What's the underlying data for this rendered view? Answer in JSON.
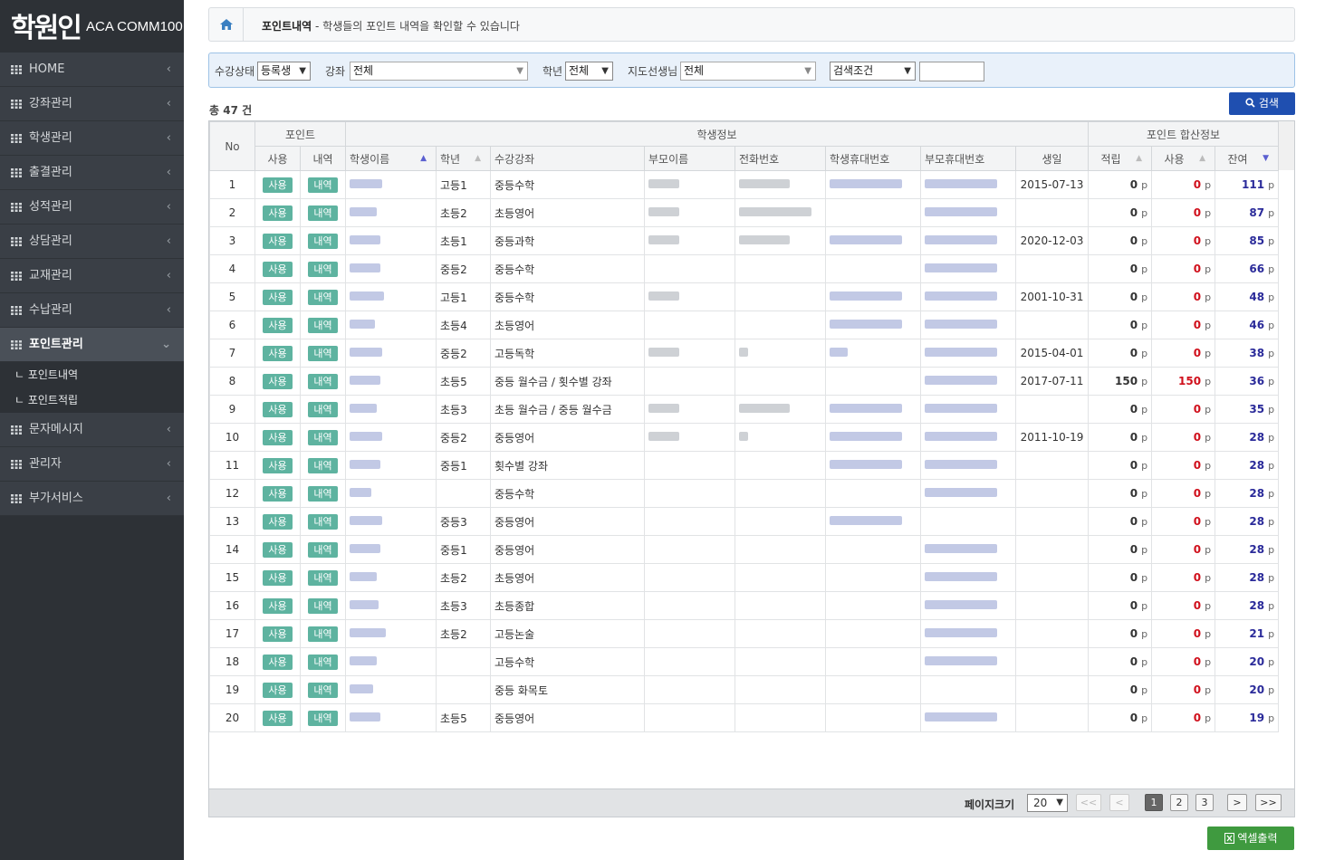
{
  "logo": {
    "mark": "학원인",
    "sub": "ACA COMM100"
  },
  "menu": [
    {
      "label": "HOME"
    },
    {
      "label": "강좌관리"
    },
    {
      "label": "학생관리"
    },
    {
      "label": "출결관리"
    },
    {
      "label": "성적관리"
    },
    {
      "label": "상담관리"
    },
    {
      "label": "교재관리"
    },
    {
      "label": "수납관리"
    },
    {
      "label": "포인트관리"
    },
    {
      "label": "문자메시지"
    },
    {
      "label": "관리자"
    },
    {
      "label": "부가서비스"
    }
  ],
  "submenu": [
    "ㄴ 포인트내역",
    "ㄴ 포인트적립"
  ],
  "breadcrumb": {
    "title": "포인트내역",
    "desc": " - 학생들의 포인트 내역을 확인할 수 있습니다"
  },
  "filter": {
    "status_label": "수강상태",
    "status_value": "등록생",
    "course_label": "강좌",
    "course_value": "전체",
    "grade_label": "학년",
    "grade_value": "전체",
    "teacher_label": "지도선생님",
    "teacher_value": "전체",
    "cond_value": "검색조건",
    "search_value": ""
  },
  "search_button": "검색",
  "total": "총 47 건",
  "headers": {
    "no": "No",
    "point": "포인트",
    "student_info": "학생정보",
    "point_sum": "포인트 합산정보",
    "use": "사용",
    "history": "내역",
    "name": "학생이름",
    "grade": "학년",
    "course": "수강강좌",
    "parent": "부모이름",
    "phone": "전화번호",
    "student_mobile": "학생휴대번호",
    "parent_mobile": "부모휴대번호",
    "birth": "생일",
    "earn": "적립",
    "spent": "사용",
    "balance": "잔여"
  },
  "tags": {
    "use": "사용",
    "history": "내역"
  },
  "unit": "p",
  "rows": [
    {
      "no": "1",
      "grade": "고등1",
      "course": "중등수학",
      "birth": "2015-07-13",
      "earn": "0",
      "spent": "0",
      "balance": "111"
    },
    {
      "no": "2",
      "grade": "초등2",
      "course": "초등영어",
      "birth": "",
      "earn": "0",
      "spent": "0",
      "balance": "87"
    },
    {
      "no": "3",
      "grade": "초등1",
      "course": "중등과학",
      "birth": "2020-12-03",
      "earn": "0",
      "spent": "0",
      "balance": "85"
    },
    {
      "no": "4",
      "grade": "중등2",
      "course": "중등수학",
      "birth": "",
      "earn": "0",
      "spent": "0",
      "balance": "66"
    },
    {
      "no": "5",
      "grade": "고등1",
      "course": "중등수학",
      "birth": "2001-10-31",
      "earn": "0",
      "spent": "0",
      "balance": "48"
    },
    {
      "no": "6",
      "grade": "초등4",
      "course": "초등영어",
      "birth": "",
      "earn": "0",
      "spent": "0",
      "balance": "46"
    },
    {
      "no": "7",
      "grade": "중등2",
      "course": "고등독학",
      "birth": "2015-04-01",
      "earn": "0",
      "spent": "0",
      "balance": "38"
    },
    {
      "no": "8",
      "grade": "초등5",
      "course": "중등 월수금 / 횟수별 강좌",
      "birth": "2017-07-11",
      "earn": "150",
      "spent": "150",
      "balance": "36"
    },
    {
      "no": "9",
      "grade": "초등3",
      "course": "초등 월수금 / 중등 월수금",
      "birth": "",
      "earn": "0",
      "spent": "0",
      "balance": "35"
    },
    {
      "no": "10",
      "grade": "중등2",
      "course": "중등영어",
      "birth": "2011-10-19",
      "earn": "0",
      "spent": "0",
      "balance": "28"
    },
    {
      "no": "11",
      "grade": "중등1",
      "course": "횟수별 강좌",
      "birth": "",
      "earn": "0",
      "spent": "0",
      "balance": "28"
    },
    {
      "no": "12",
      "grade": "",
      "course": "중등수학",
      "birth": "",
      "earn": "0",
      "spent": "0",
      "balance": "28"
    },
    {
      "no": "13",
      "grade": "중등3",
      "course": "중등영어",
      "birth": "",
      "earn": "0",
      "spent": "0",
      "balance": "28"
    },
    {
      "no": "14",
      "grade": "중등1",
      "course": "중등영어",
      "birth": "",
      "earn": "0",
      "spent": "0",
      "balance": "28"
    },
    {
      "no": "15",
      "grade": "초등2",
      "course": "초등영어",
      "birth": "",
      "earn": "0",
      "spent": "0",
      "balance": "28"
    },
    {
      "no": "16",
      "grade": "초등3",
      "course": "초등종합",
      "birth": "",
      "earn": "0",
      "spent": "0",
      "balance": "28"
    },
    {
      "no": "17",
      "grade": "초등2",
      "course": "고등논술",
      "birth": "",
      "earn": "0",
      "spent": "0",
      "balance": "21"
    },
    {
      "no": "18",
      "grade": "",
      "course": "고등수학",
      "birth": "",
      "earn": "0",
      "spent": "0",
      "balance": "20"
    },
    {
      "no": "19",
      "grade": "",
      "course": "중등 화목토",
      "birth": "",
      "earn": "0",
      "spent": "0",
      "balance": "20"
    },
    {
      "no": "20",
      "grade": "초등5",
      "course": "중등영어",
      "birth": "",
      "earn": "0",
      "spent": "0",
      "balance": "19"
    }
  ],
  "pager": {
    "label": "페이지크기",
    "size": "20",
    "first": "<<",
    "prev": "<",
    "pages": [
      "1",
      "2",
      "3"
    ],
    "next": ">",
    "last": ">>"
  },
  "excel_button": "엑셀출력",
  "colors": {
    "sidebar": "#2d3136",
    "accent": "#1f4fb0",
    "tag": "#5eb3a0",
    "red": "#d0101c",
    "excel": "#3f9a3f"
  }
}
